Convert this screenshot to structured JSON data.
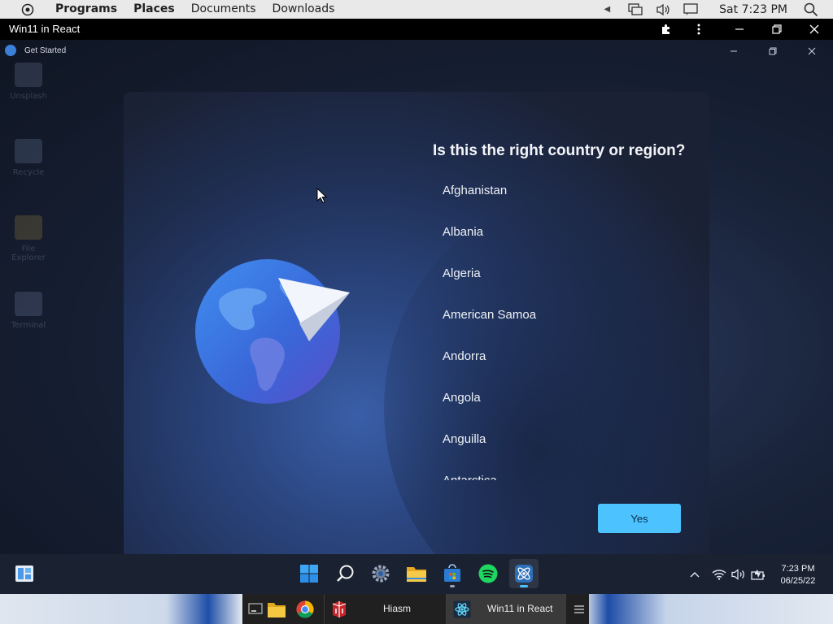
{
  "topbar": {
    "menus": [
      "Programs",
      "Places",
      "Documents",
      "Downloads"
    ],
    "clock": "Sat 7:23 PM"
  },
  "chrome_app": {
    "title": "Win11 in React"
  },
  "desktop": {
    "icons": [
      "Unsplash",
      "Recycle",
      "File Explorer",
      "Terminal"
    ]
  },
  "get_started": {
    "window_title": "Get Started",
    "question": "Is this the right country or region?",
    "countries": [
      "Afghanistan",
      "Albania",
      "Algeria",
      "American Samoa",
      "Andorra",
      "Angola",
      "Anguilla",
      "Antarctica"
    ],
    "yes_label": "Yes",
    "accent_color": "#4cc2ff"
  },
  "taskbar": {
    "apps": [
      "widgets-icon",
      "start-icon",
      "search-icon",
      "settings-icon",
      "file-explorer-icon",
      "store-icon",
      "spotify-icon",
      "win11-react-icon"
    ],
    "time": "7:23 PM",
    "date": "06/25/22"
  },
  "dock": {
    "tasks": [
      {
        "label": "Hiasm"
      },
      {
        "label": "Win11 in React"
      }
    ]
  }
}
